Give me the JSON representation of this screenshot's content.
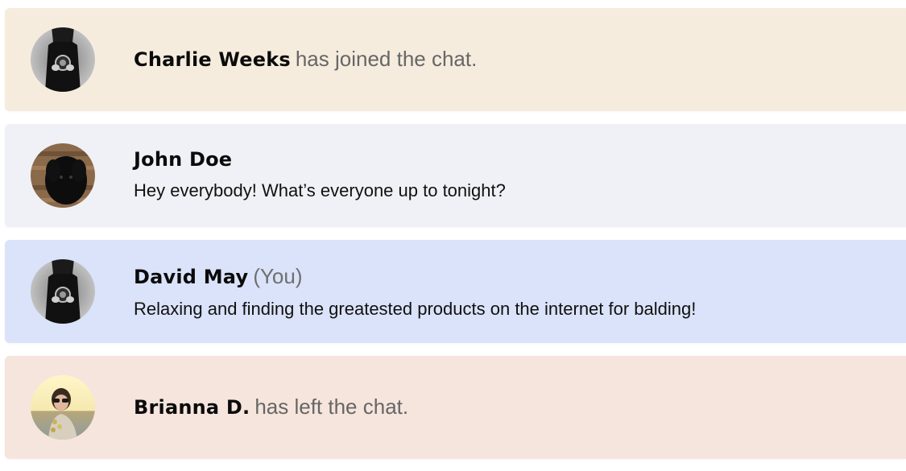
{
  "colors": {
    "join_bg": "#f6ecde",
    "message_bg": "#f0f1f6",
    "self_bg": "#dae3f9",
    "leave_bg": "#f6e5dd",
    "name_color": "#0b0b0b",
    "muted_color": "#666666"
  },
  "chat": {
    "rows": [
      {
        "kind": "event",
        "avatar_icon": "photographer-avatar",
        "name": "Charlie Weeks",
        "event_text": "has joined the chat."
      },
      {
        "kind": "message",
        "avatar_icon": "black-dog-avatar",
        "name": "John Doe",
        "message": "Hey everybody! What’s everyone up to tonight?"
      },
      {
        "kind": "message",
        "avatar_icon": "photographer-avatar",
        "name": "David May",
        "you_label": "(You)",
        "message": "Relaxing and finding the greatested products on the internet for balding!"
      },
      {
        "kind": "event",
        "avatar_icon": "woman-sunglasses-avatar",
        "name": "Brianna D.",
        "event_text": "has left the chat."
      }
    ]
  }
}
